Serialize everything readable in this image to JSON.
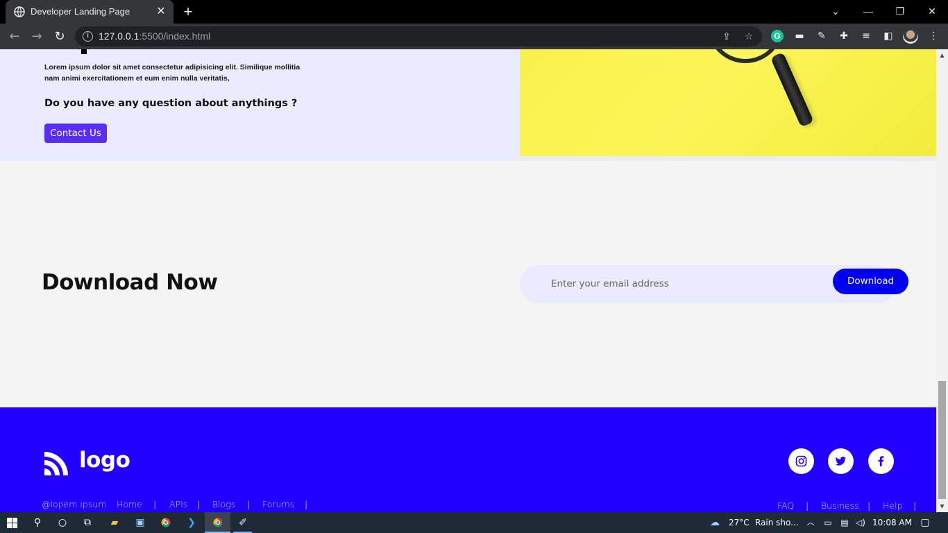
{
  "browser": {
    "tab_title": "Developer Landing Page",
    "tab_close": "✕",
    "new_tab": "+",
    "url_host": "127.0.0.1",
    "url_rest": ":5500/index.html",
    "window_controls": {
      "minimize": "—",
      "restore": "❐",
      "close": "✕",
      "tab_search": "⌄"
    },
    "extension_grammarly": "G"
  },
  "hero": {
    "description": "Lorem ipsum dolor sit amet consectetur adipisicing elit. Similique mollitia nam animi exercitationem et eum enim nulla veritatis,",
    "question": "Do you have any question about anythings ?",
    "contact_label": "Contact Us"
  },
  "download": {
    "title_bold": "Download",
    "title_rest": " Now",
    "email_placeholder": "Enter your email address",
    "button_label": "Download"
  },
  "footer": {
    "logo_text": "logo",
    "copyright": "@lopem ipsum",
    "left_links": [
      "Home",
      "APIs",
      "Blogs",
      "Forums"
    ],
    "right_links": [
      "FAQ",
      "Business",
      "Help"
    ],
    "separator": "|",
    "social": [
      "instagram-icon",
      "twitter-icon",
      "facebook-icon"
    ]
  },
  "taskbar": {
    "weather": "27°C",
    "weather_desc": "Rain sho...",
    "time": "10:08 AM"
  },
  "colors": {
    "primary": "#2200ff",
    "download_button": "#0000ee",
    "contact_button": "#5a2ef0",
    "hero_bg": "#ebebff",
    "page_bg": "#f4f4f4"
  }
}
